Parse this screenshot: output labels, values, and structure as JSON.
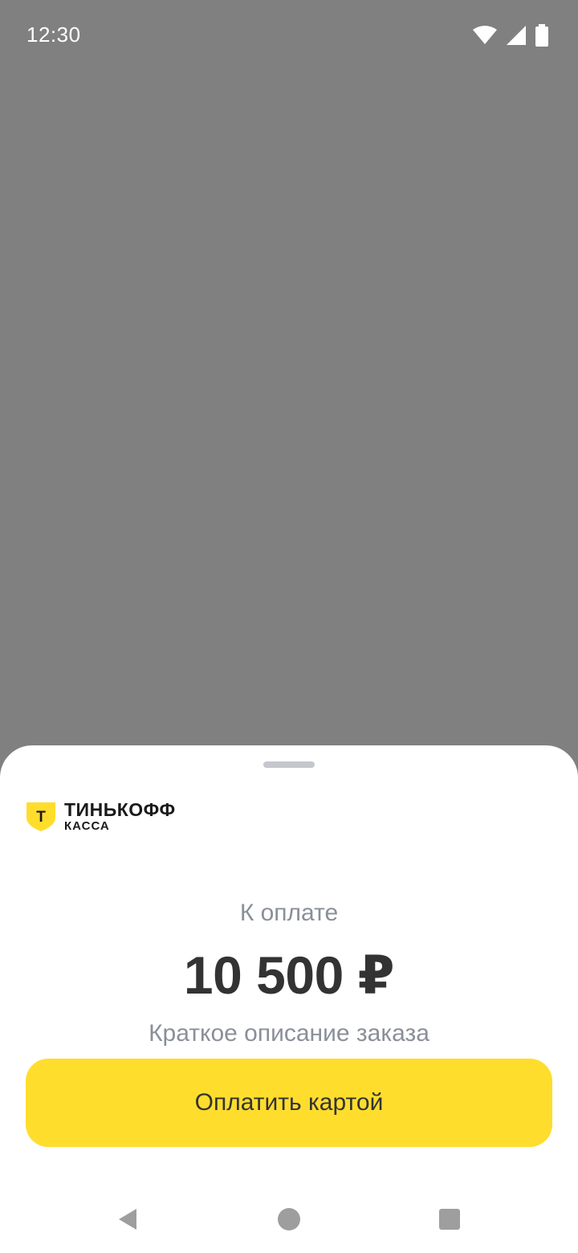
{
  "status_bar": {
    "time": "12:30",
    "icons": [
      "wifi-icon",
      "cellular-signal-icon",
      "battery-icon"
    ]
  },
  "payment_sheet": {
    "logo": {
      "name": "ТИНЬКОФФ",
      "subtitle": "КАССА",
      "emblem_letter": "Т"
    },
    "amount_caption": "К оплате",
    "amount": "10 500 ₽",
    "order_description": "Краткое описание заказа",
    "pay_button_label": "Оплатить картой"
  },
  "navigation_bar": {
    "icons": [
      "back-icon",
      "home-icon",
      "recents-icon"
    ]
  },
  "colors": {
    "scrim": "#808080",
    "sheet_background": "#ffffff",
    "accent_yellow": "#ffdd2d",
    "primary_text": "#333333",
    "secondary_text": "#8a8f99",
    "nav_icon": "#9e9e9e"
  }
}
